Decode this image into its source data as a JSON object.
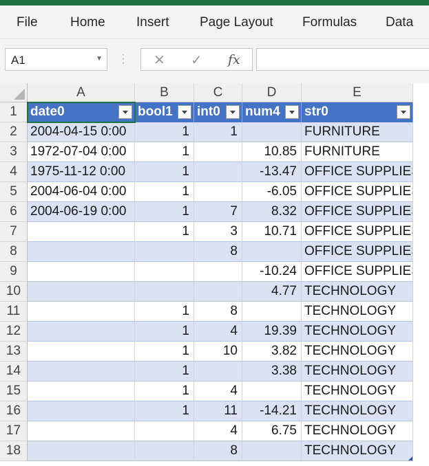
{
  "ribbon": {
    "tabs": [
      "File",
      "Home",
      "Insert",
      "Page Layout",
      "Formulas",
      "Data"
    ]
  },
  "formula_bar": {
    "name_box": "A1",
    "cancel_icon": "✕",
    "enter_icon": "✓",
    "fx_label": "fx",
    "formula": ""
  },
  "columns": [
    "A",
    "B",
    "C",
    "D",
    "E"
  ],
  "headers": [
    "date0",
    "bool1",
    "int0",
    "num4",
    "str0"
  ],
  "rows": [
    [
      "2004-04-15 0:00",
      "1",
      "1",
      "",
      "FURNITURE"
    ],
    [
      "1972-07-04 0:00",
      "1",
      "",
      "10.85",
      "FURNITURE"
    ],
    [
      "1975-11-12 0:00",
      "1",
      "",
      "-13.47",
      "OFFICE SUPPLIES"
    ],
    [
      "2004-06-04 0:00",
      "1",
      "",
      "-6.05",
      "OFFICE SUPPLIES"
    ],
    [
      "2004-06-19 0:00",
      "1",
      "7",
      "8.32",
      "OFFICE SUPPLIES"
    ],
    [
      "",
      "1",
      "3",
      "10.71",
      "OFFICE SUPPLIES"
    ],
    [
      "",
      "",
      "8",
      "",
      "OFFICE SUPPLIES"
    ],
    [
      "",
      "",
      "",
      "-10.24",
      "OFFICE SUPPLIES"
    ],
    [
      "",
      "",
      "",
      "4.77",
      "TECHNOLOGY"
    ],
    [
      "",
      "1",
      "8",
      "",
      "TECHNOLOGY"
    ],
    [
      "",
      "1",
      "4",
      "19.39",
      "TECHNOLOGY"
    ],
    [
      "",
      "1",
      "10",
      "3.82",
      "TECHNOLOGY"
    ],
    [
      "",
      "1",
      "",
      "3.38",
      "TECHNOLOGY"
    ],
    [
      "",
      "1",
      "4",
      "",
      "TECHNOLOGY"
    ],
    [
      "",
      "1",
      "11",
      "-14.21",
      "TECHNOLOGY"
    ],
    [
      "",
      "",
      "4",
      "6.75",
      "TECHNOLOGY"
    ],
    [
      "",
      "",
      "8",
      "",
      "TECHNOLOGY"
    ]
  ],
  "row_numbers": [
    "1",
    "2",
    "3",
    "4",
    "5",
    "6",
    "7",
    "8",
    "9",
    "10",
    "11",
    "12",
    "13",
    "14",
    "15",
    "16",
    "17",
    "18"
  ],
  "colors": {
    "accent": "#217346",
    "table_header": "#4472c4",
    "band": "#d9e1f2"
  }
}
